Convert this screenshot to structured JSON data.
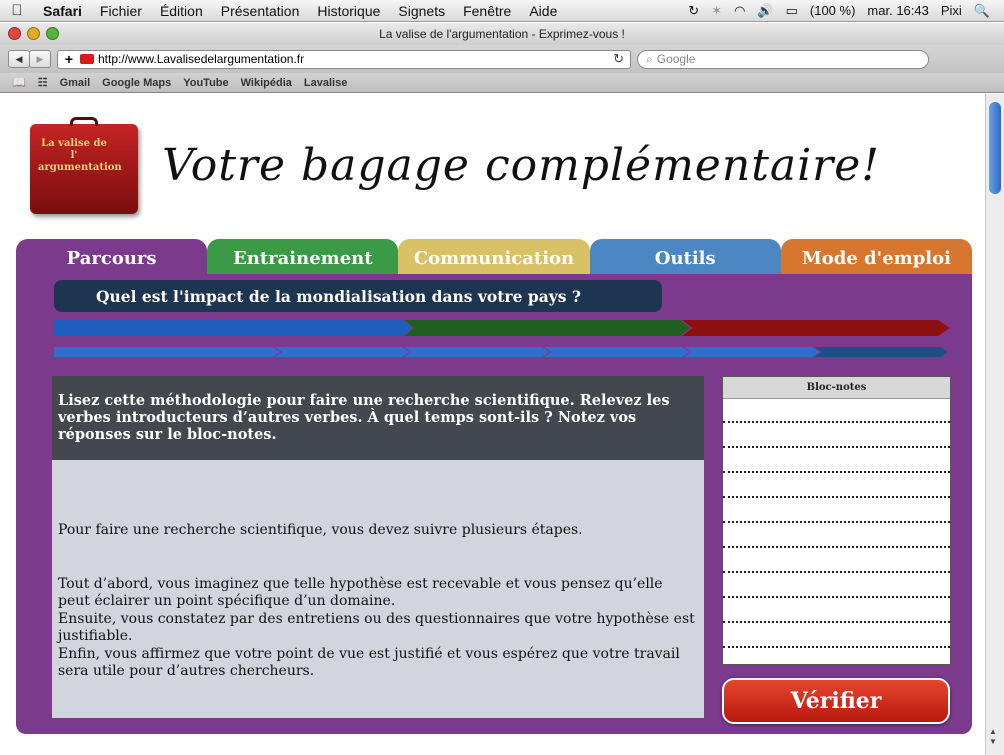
{
  "menubar": {
    "items": [
      "Safari",
      "Fichier",
      "Édition",
      "Présentation",
      "Historique",
      "Signets",
      "Fenêtre",
      "Aide"
    ],
    "battery": "(100 %)",
    "clock": "mar. 16:43",
    "user": "Pixi"
  },
  "window": {
    "title": "La valise de l'argumentation - Exprimez-vous !",
    "url": "http://www.Lavalisedelargumentation.fr",
    "search_placeholder": "Google"
  },
  "bookmarks": [
    "Gmail",
    "Google Maps",
    "YouTube",
    "Wikipédia",
    "Lavalise"
  ],
  "header": {
    "logo_text": "La valise de l' argumentation",
    "slogan": "Votre bagage complémentaire!"
  },
  "tabs": [
    {
      "label": "Parcours",
      "color": "#7b3a8c"
    },
    {
      "label": "Entrainement",
      "color": "#3a9a46"
    },
    {
      "label": "Communication",
      "color": "#d9c266"
    },
    {
      "label": "Outils",
      "color": "#4c86c3"
    },
    {
      "label": "Mode d'emploi",
      "color": "#d7772f"
    }
  ],
  "question": "Quel est l'impact de la mondialisation dans votre pays ?",
  "progress_colors": {
    "main": [
      "#1c5fbf",
      "#1e5e1e",
      "#8c1010"
    ],
    "steps": [
      "#2e6fcd",
      "#2e6fcd",
      "#2e6fcd",
      "#2e6fcd",
      "#2e6fcd",
      "#1d4f86",
      "#1d4f86"
    ]
  },
  "instructions": "Lisez cette méthodologie pour faire une recherche scientifique. Relevez les verbes introducteurs d’autres verbes. À quel temps sont-ils ? Notez vos réponses sur le bloc-notes.",
  "paragraphs": [
    "Pour faire une recherche scientifique, vous devez suivre plusieurs étapes.",
    "Tout d’abord, vous imaginez que telle hypothèse est recevable et vous pensez qu’elle peut éclairer un point spécifique d’un domaine.",
    "Ensuite, vous constatez par des entretiens ou des questionnaires que votre hypothèse est justifiable.",
    "Enfin, vous affirmez que votre point de vue est justifié et vous espérez que votre travail sera utile pour d’autres chercheurs."
  ],
  "notepad": {
    "title": "Bloc-notes"
  },
  "verify_label": "Vérifier"
}
